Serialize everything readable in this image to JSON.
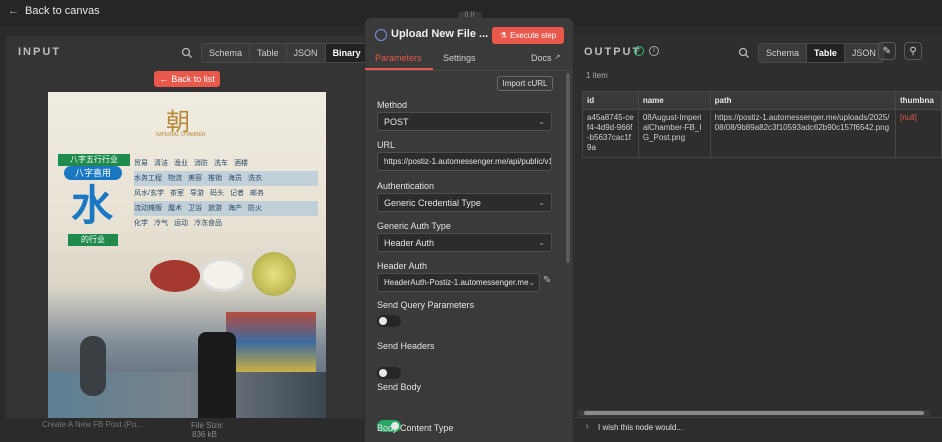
{
  "header": {
    "back_label": "Back to canvas"
  },
  "input": {
    "title": "INPUT",
    "tabs": [
      "Schema",
      "Table",
      "JSON",
      "Binary"
    ],
    "active_tab": "Binary",
    "back_to_list": "Back to list",
    "poster": {
      "logo_cn": "朝",
      "logo_en": "IMPERIAL CHAMBER",
      "banner1": "八字五行行业",
      "banner2": "八字喜用",
      "big_char": "水",
      "banner3": "的行业",
      "rows": [
        [
          "贸易",
          "清洁",
          "渔业",
          "消防",
          "洗车",
          "酒楼"
        ],
        [
          "水务工程",
          "物流",
          "美容",
          "推销",
          "海员",
          "洗衣"
        ],
        [
          "风水/玄学",
          "茶室",
          "导游",
          "码头",
          "记者",
          "邮务"
        ],
        [
          "流动摊贩",
          "魔术",
          "卫浴",
          "旅游",
          "海产",
          "防火"
        ],
        [
          "化学",
          "冷气",
          "运动",
          "冷冻食品"
        ]
      ]
    },
    "footer_node": "Create A New FB Post (Po...",
    "footer_size_label": "File Size:",
    "footer_size": "836 kB"
  },
  "params": {
    "title": "Upload New File ...",
    "execute_label": "Execute step",
    "tabs": [
      "Parameters",
      "Settings",
      "Docs"
    ],
    "active_tab": "Parameters",
    "import_curl": "Import cURL",
    "method_label": "Method",
    "method_value": "POST",
    "url_label": "URL",
    "url_value": "https://postiz-1.automessenger.me/api/public/v1",
    "auth_label": "Authentication",
    "auth_value": "Generic Credential Type",
    "gen_auth_label": "Generic Auth Type",
    "gen_auth_value": "Header Auth",
    "header_auth_label": "Header Auth",
    "header_auth_value": "HeaderAuth-Postiz-1.automessenger.me",
    "send_query_label": "Send Query Parameters",
    "send_headers_label": "Send Headers",
    "send_body_label": "Send Body",
    "body_content_label": "Body Content Type",
    "send_query": false,
    "send_headers": false,
    "send_body": true
  },
  "output": {
    "title": "OUTPUT",
    "tabs": [
      "Schema",
      "Table",
      "JSON"
    ],
    "active_tab": "Table",
    "count": "1 item",
    "columns": [
      "id",
      "name",
      "path",
      "thumbna"
    ],
    "row": {
      "id": "a45a8745-cef4-4d9d-966f-b5637cac1f9a",
      "name": "08August-ImperialChamber-FB_IG_Post.png",
      "path": "https://postiz-1.automessenger.me/uploads/2025/08/08/9b89a82c3f10593adc62b90c157f6542.png",
      "thumb": "[null]"
    },
    "feedback": "I wish this node would..."
  }
}
